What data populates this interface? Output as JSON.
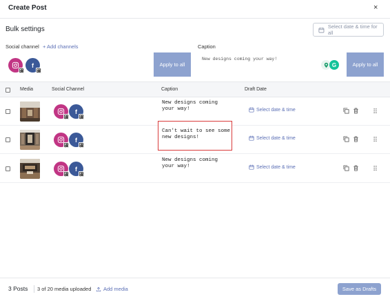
{
  "modal": {
    "title": "Create Post",
    "close_icon": "×"
  },
  "bulk": {
    "title": "Bulk settings",
    "date_all_label": "Select date & time for all",
    "social_label": "Social channel",
    "add_channels": "+ Add channels",
    "caption_label": "Caption",
    "caption_value": "New designs coming your way!",
    "apply_label": "Apply to all",
    "apply_caption_label": "Apply to all"
  },
  "channels": [
    {
      "icon": "instagram-icon",
      "glyph": "◎",
      "color": "#c13584"
    },
    {
      "icon": "facebook-icon",
      "glyph": "f",
      "color": "#3b5998"
    }
  ],
  "table": {
    "headers": {
      "media": "Media",
      "channel": "Social Channel",
      "caption": "Caption",
      "draft_date": "Draft Date"
    },
    "rows": [
      {
        "caption": "New designs coming\nyour way!",
        "date_label": "Select date & time"
      },
      {
        "caption": "Can't wait to see some\nnew designs!",
        "date_label": "Select date & time"
      },
      {
        "caption": "New designs coming\nyour way!",
        "date_label": "Select date & time"
      }
    ]
  },
  "footer": {
    "count": "3 Posts",
    "media_status": "3 of 20 media uploaded",
    "add_media": "Add media",
    "save_label": "Save as Drafts"
  }
}
